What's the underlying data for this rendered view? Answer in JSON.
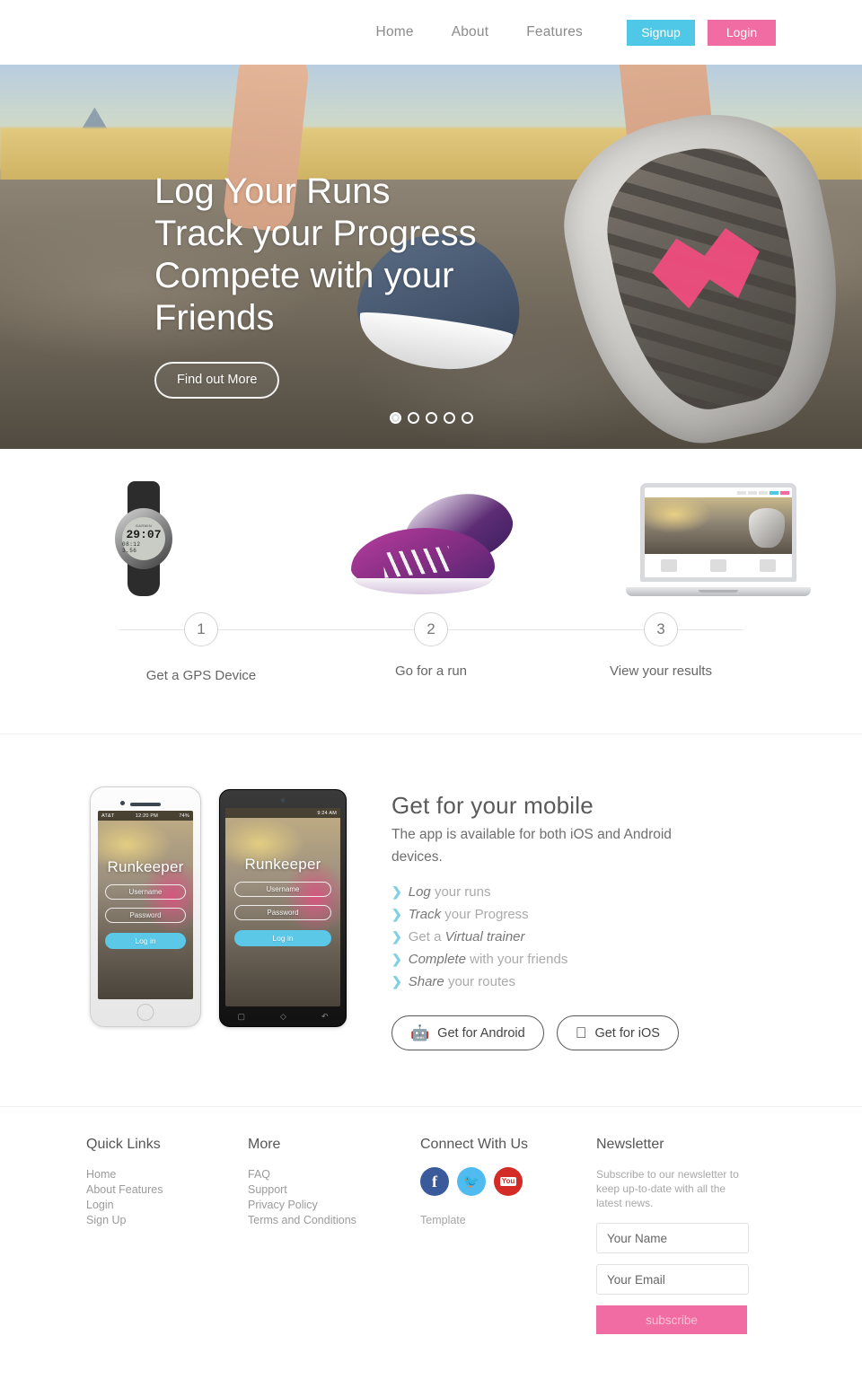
{
  "header": {
    "nav_links": [
      {
        "label": "Home"
      },
      {
        "label": "About"
      },
      {
        "label": "Features"
      }
    ],
    "signup_label": "Signup",
    "login_label": "Login",
    "signup_color": "#4fc8e8",
    "login_color": "#f06ca2"
  },
  "hero": {
    "heading_line1": "Log Your Runs",
    "heading_line2": "Track your Progress",
    "heading_line3": "Compete with your Friends",
    "cta_label": "Find out More",
    "carousel_dots": 5,
    "active_dot": 1
  },
  "steps": {
    "items": [
      {
        "number": "1",
        "label": "Get a GPS Device",
        "image": "gps-watch"
      },
      {
        "number": "2",
        "label": "Go for a run",
        "image": "running-shoes"
      },
      {
        "number": "3",
        "label": "View your results",
        "image": "laptop"
      }
    ],
    "watch": {
      "brand": "GARMIN",
      "time": "29:07",
      "pace": "08:12",
      "distance": "3.56"
    }
  },
  "mobile": {
    "heading": "Get for your mobile",
    "paragraph": "The app is available for both iOS and Android devices.",
    "features": [
      {
        "emphasis": "Log",
        "rest": "your runs",
        "emphasis_first": true
      },
      {
        "emphasis": "Track",
        "rest": "your Progress",
        "emphasis_first": true
      },
      {
        "emphasis": "Virtual trainer",
        "rest": "Get a",
        "emphasis_first": false
      },
      {
        "emphasis": "Complete",
        "rest": "with your friends",
        "emphasis_first": true
      },
      {
        "emphasis": "Share",
        "rest": "your routes",
        "emphasis_first": true
      }
    ],
    "android_button": "Get for Android",
    "ios_button": "Get for iOS",
    "phone_screen": {
      "app_name": "Runkeeper",
      "username_placeholder": "Username",
      "password_placeholder": "Password",
      "login_label": "Log in",
      "ios_carrier": "AT&T",
      "ios_time": "12:20 PM",
      "ios_battery": "74%",
      "android_time": "9:24 AM"
    }
  },
  "footer": {
    "quick_links": {
      "title": "Quick Links",
      "items": [
        {
          "label": "Home"
        },
        {
          "label": "About Features"
        },
        {
          "label": "Login"
        },
        {
          "label": "Sign Up"
        }
      ]
    },
    "more": {
      "title": "More",
      "items": [
        {
          "label": "FAQ"
        },
        {
          "label": "Support"
        },
        {
          "label": "Privacy Policy"
        },
        {
          "label": "Terms and Conditions"
        }
      ]
    },
    "connect": {
      "title": "Connect With Us",
      "socials": [
        {
          "name": "facebook",
          "glyph": "f",
          "color": "#3b5a9b"
        },
        {
          "name": "twitter",
          "glyph": "ᵕ",
          "color": "#4fbbf0"
        },
        {
          "name": "youtube",
          "glyph": "You",
          "color": "#d32c27"
        }
      ],
      "template_label": "Template"
    },
    "newsletter": {
      "title": "Newsletter",
      "description": "Subscribe to our newsletter to keep up-to-date with all the latest news.",
      "name_placeholder": "Your Name",
      "email_placeholder": "Your Email",
      "button_label": "subscribe"
    }
  }
}
